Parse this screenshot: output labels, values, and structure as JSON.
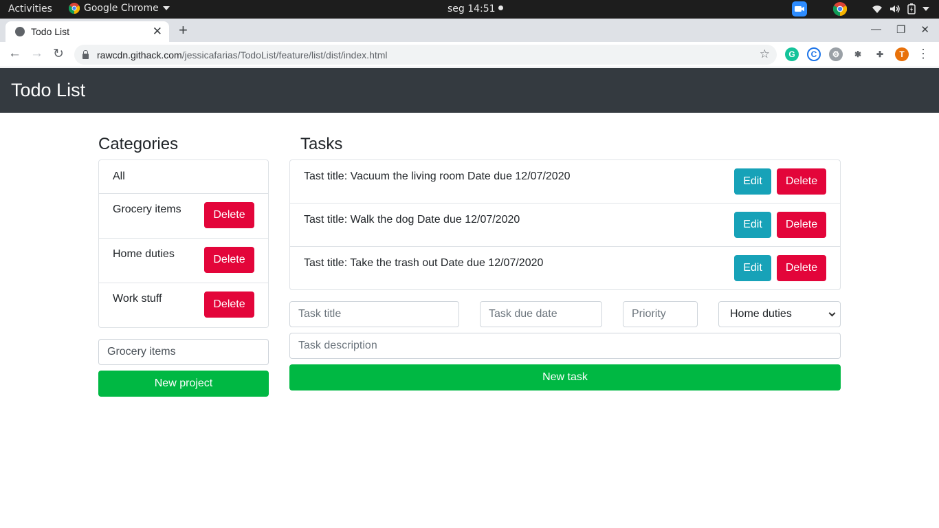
{
  "os": {
    "activities": "Activities",
    "app_name": "Google Chrome",
    "clock": "seg 14:51"
  },
  "browser": {
    "tab_title": "Todo List",
    "url_host": "rawcdn.githack.com",
    "url_path": "/jessicafarias/TodoList/feature/list/dist/index.html",
    "avatar_letter": "T",
    "accent": "#e8710a"
  },
  "navbar": {
    "brand": "Todo List",
    "bg": "#343a40"
  },
  "categories": {
    "heading": "Categories",
    "items": [
      {
        "label": "All"
      },
      {
        "label": "Grocery items",
        "delete_label": "Delete"
      },
      {
        "label": "Home duties",
        "delete_label": "Delete"
      },
      {
        "label": "Work stuff",
        "delete_label": "Delete"
      }
    ],
    "new_project_input_value": "Grocery items",
    "new_project_label": "New project"
  },
  "tasks": {
    "heading": "Tasks",
    "items": [
      {
        "text": "Tast title: Vacuum the living room Date due 12/07/2020",
        "edit_label": "Edit",
        "delete_label": "Delete"
      },
      {
        "text": "Tast title: Walk the dog Date due 12/07/2020",
        "edit_label": "Edit",
        "delete_label": "Delete"
      },
      {
        "text": "Tast title: Take the trash out Date due 12/07/2020",
        "edit_label": "Edit",
        "delete_label": "Delete"
      }
    ],
    "form": {
      "title_placeholder": "Task title",
      "due_placeholder": "Task due date",
      "priority_placeholder": "Priority",
      "category_selected": "Home duties",
      "description_placeholder": "Task description",
      "submit_label": "New task"
    }
  },
  "colors": {
    "danger": "#e3053a",
    "info": "#17a2b8",
    "success": "#00b843"
  }
}
